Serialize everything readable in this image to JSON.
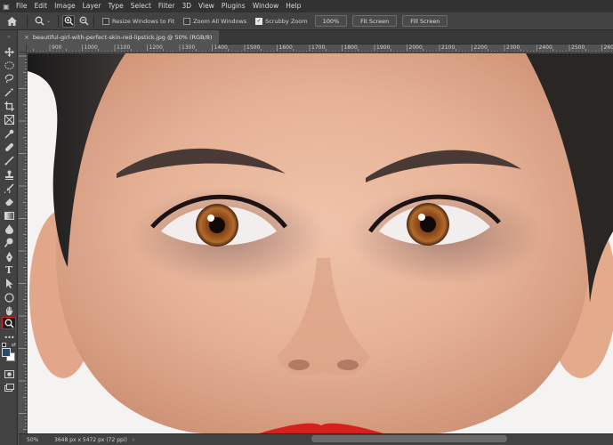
{
  "menu": [
    "File",
    "Edit",
    "Image",
    "Layer",
    "Type",
    "Select",
    "Filter",
    "3D",
    "View",
    "Plugins",
    "Window",
    "Help"
  ],
  "options": {
    "resize_windows": "Resize Windows to Fit",
    "zoom_all": "Zoom All Windows",
    "scrubby": "Scrubby Zoom",
    "zoom_value": "100%",
    "fit_screen": "Fit Screen",
    "fill_screen": "Fill Screen"
  },
  "document": {
    "tab_title": "beautiful-girl-with-perfect-skin-red-lipstick.jpg @ 50% (RGB/8)",
    "close": "×"
  },
  "ruler": {
    "labels": [
      "900",
      "1000",
      "1100",
      "1200",
      "1300",
      "1400",
      "1500",
      "1600",
      "1700",
      "1800",
      "1900",
      "2000",
      "2100",
      "2200",
      "2300",
      "2400",
      "2500",
      "2600",
      "2700"
    ]
  },
  "status": {
    "zoom": "50%",
    "doc_info": "3648 px x 5472 px (72 ppi)",
    "chevron": "›"
  },
  "colors": {
    "accent_active_tool": "#e02020",
    "foreground_swatch": "#2a4a6a",
    "background_swatch": "#ffffff"
  }
}
